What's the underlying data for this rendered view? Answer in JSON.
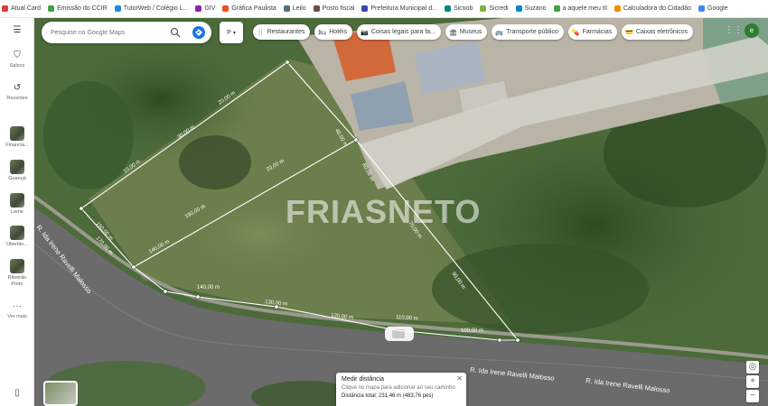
{
  "bookmarks": [
    {
      "label": "Atual Card",
      "color": "#e53935"
    },
    {
      "label": "Emissão do CCIR",
      "color": "#43a047"
    },
    {
      "label": "TutorWeb / Colégio L...",
      "color": "#1e88e5"
    },
    {
      "label": "GIV",
      "color": "#8e24aa"
    },
    {
      "label": "Gráfica Paulista",
      "color": "#f4511e"
    },
    {
      "label": "Leilo",
      "color": "#546e7a"
    },
    {
      "label": "Posto fiscal",
      "color": "#6d4c41"
    },
    {
      "label": "Prefeitura Municipal d...",
      "color": "#3949ab"
    },
    {
      "label": "Sicoob",
      "color": "#00897b"
    },
    {
      "label": "Sicredi",
      "color": "#7cb342"
    },
    {
      "label": "Suzano",
      "color": "#0288d1"
    },
    {
      "label": "a aquele meu til",
      "color": "#43a047"
    },
    {
      "label": "Calculadora do Cidadão",
      "color": "#fb8c00"
    },
    {
      "label": "Google",
      "color": "#4285f4"
    }
  ],
  "rail": {
    "menu_icon": "menu-icon",
    "items": [
      {
        "label": "Salvos",
        "icon": "bookmark-icon"
      },
      {
        "label": "Recentes",
        "icon": "history-icon"
      },
      {
        "label": "Financia...",
        "icon": "place-thumbnail"
      },
      {
        "label": "Guarujá",
        "icon": "place-thumbnail"
      },
      {
        "label": "Leme",
        "icon": "place-thumbnail"
      },
      {
        "label": "Uberlân...",
        "icon": "place-thumbnail"
      },
      {
        "label": "Ribeirão Preto",
        "icon": "place-thumbnail"
      },
      {
        "label": "Ver mais",
        "icon": "more-icon"
      }
    ]
  },
  "search": {
    "placeholder": "Pesquise no Google Maps"
  },
  "layer_button": {
    "label": "P"
  },
  "chips": [
    {
      "label": "Restaurantes",
      "icon": "🍴"
    },
    {
      "label": "Hotéis",
      "icon": "🛏"
    },
    {
      "label": "Coisas legais para fa...",
      "icon": "📷"
    },
    {
      "label": "Museus",
      "icon": "🏛"
    },
    {
      "label": "Transporte público",
      "icon": "🚌"
    },
    {
      "label": "Farmácias",
      "icon": "💊"
    },
    {
      "label": "Caixas eletrônicos",
      "icon": "💳"
    }
  ],
  "avatar": {
    "initial": "e",
    "color": "#2e7d32"
  },
  "watermark": "FRIASNETO",
  "measurements": {
    "segments": [
      "20,00 m",
      "30,00 m",
      "10,00 m",
      "40,00 m",
      "80,00 m",
      "20,00 m",
      "110,00 m",
      "190,00 m",
      "140,00 m",
      "150,00 m",
      "130,00 m",
      "170,00 m",
      "120,00 m",
      "140,00 m",
      "110,00 m",
      "100,00 m",
      "70,00 m",
      "90,00 m"
    ]
  },
  "road_labels": [
    "R. Ida Irene Ravelli Malosso",
    "R. Ida Irene Ravelli Malosso",
    "R. Ida Irene Ravelli Malosso"
  ],
  "distance_card": {
    "title": "Medir distância",
    "subtitle": "Clique no mapa para adicionar ao seu caminho",
    "total": "Distância total: 231,46 m (483,76 pés)",
    "close_icon": "close-icon"
  },
  "colors": {
    "accent": "#1a73e8",
    "measure_line": "#ffffff"
  }
}
